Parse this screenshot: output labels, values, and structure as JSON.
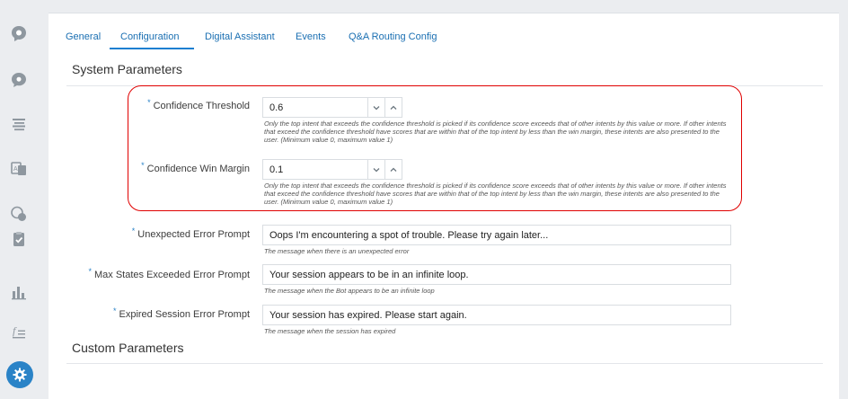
{
  "tabs": [
    "General",
    "Configuration",
    "Digital Assistant",
    "Events",
    "Q&A Routing Config"
  ],
  "active_tab": "Configuration",
  "sections": {
    "system": "System Parameters",
    "custom": "Custom Parameters"
  },
  "required_marker": "*",
  "confidence_threshold": {
    "label": "Confidence Threshold",
    "value": "0.6",
    "help": "Only the top intent that exceeds the confidence threshold is picked if its confidence score exceeds that of other intents by this value or more. If other intents that exceed the confidence threshold have scores that are within that of the top intent by less than the win margin, these intents are also presented to the user. (Minimum value 0, maximum value 1)"
  },
  "confidence_win_margin": {
    "label": "Confidence Win Margin",
    "value": "0.1",
    "help": "Only the top intent that exceeds the confidence threshold is picked if its confidence score exceeds that of other intents by this value or more. If other intents that exceed the confidence threshold have scores that are within that of the top intent by less than the win margin, these intents are also presented to the user. (Minimum value 0, maximum value 1)"
  },
  "unexpected_error": {
    "label": "Unexpected Error Prompt",
    "value": "Oops I'm encountering a spot of trouble. Please try again later...",
    "help": "The message when there is an unexpected error"
  },
  "max_states": {
    "label": "Max States Exceeded Error Prompt",
    "value": "Your session appears to be in an infinite loop.",
    "help": "The message when the Bot appears to be an infinite loop"
  },
  "expired_session": {
    "label": "Expired Session Error Prompt",
    "value": "Your session has expired.  Please start again.",
    "help": "The message when the session has expired"
  },
  "sidebar_icons": [
    "bot-icon",
    "chat-bubble-icon",
    "list-icon",
    "translate-icon",
    "qna-icon",
    "clipboard-check-icon",
    "bar-chart-icon",
    "function-icon",
    "gear-icon"
  ],
  "colors": {
    "accent": "#2a83c7",
    "highlight_border": "#e00000",
    "tab_text": "#1a6fb2"
  }
}
